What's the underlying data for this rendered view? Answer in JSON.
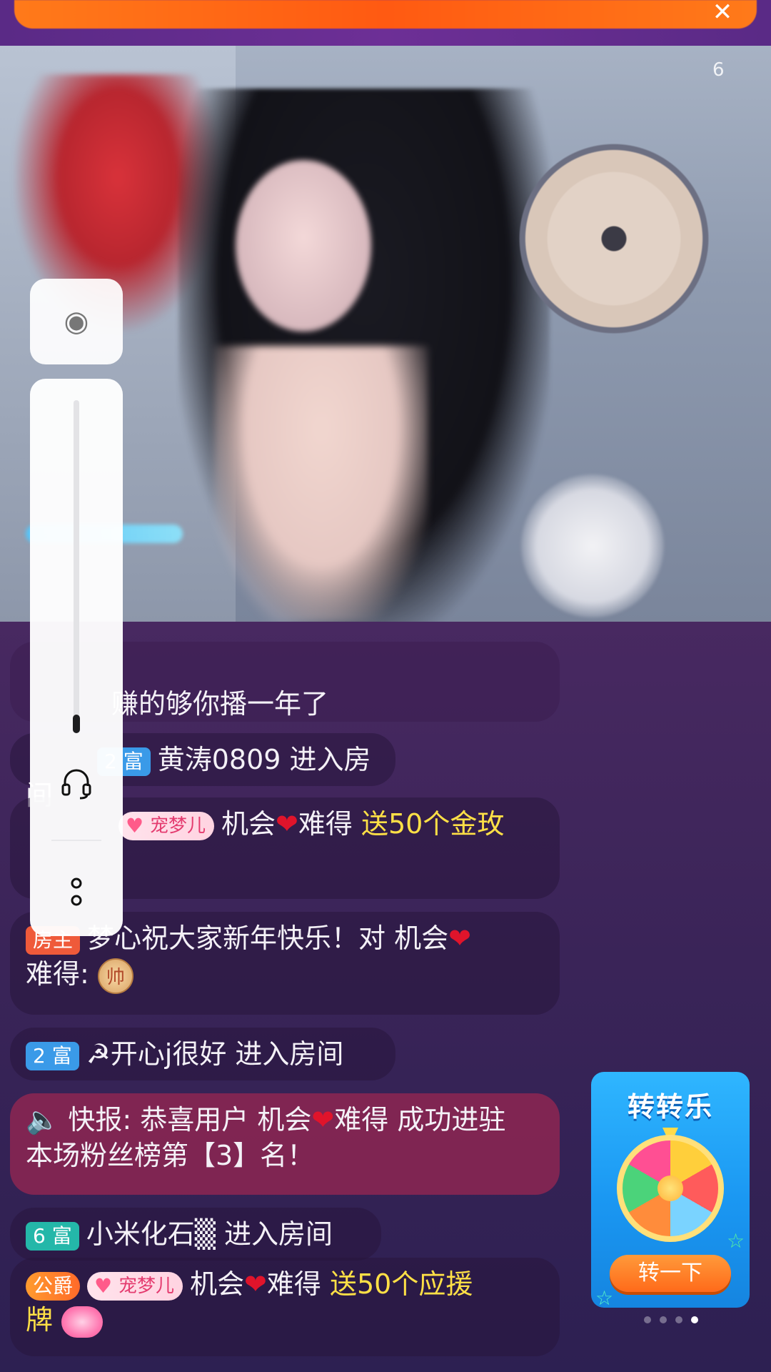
{
  "colors": {
    "accent_yellow": "#ffe046",
    "heart_red": "#e0142b",
    "badge_blue": "#3a9ae8",
    "badge_teal": "#24b7a9",
    "badge_red": "#ef5a3a",
    "game_blue": "#1a97f2",
    "spin_orange": "#ff6a1a"
  },
  "top_banner": {
    "close_icon": "close-icon"
  },
  "video": {
    "watermark_icon": "app-logo-icon"
  },
  "side_panel": {
    "top_icon": "toggle-icon",
    "headset_icon": "headset-icon",
    "more_icon": "more-vertical-icon"
  },
  "chat": [
    {
      "text_a": "赚的够你播一年了"
    },
    {
      "badge": "2 富",
      "text": "黄涛0809 进入房间"
    },
    {
      "pet": "宠梦儿",
      "user": "机会",
      "mid": "难得",
      "gift": "送50个金玫"
    },
    {
      "badge": "房主",
      "text": "梦心祝大家新年快乐！对 机会",
      "line2": "难得:",
      "coin": "帅"
    },
    {
      "badge": "2 富",
      "text": "☭开心j很好 进入房间"
    },
    {
      "icon": "speaker-icon",
      "line1": "快报: 恭喜用户 机会",
      "line1b": "难得 成功进驻",
      "line2": "本场粉丝榜第【3】名！"
    },
    {
      "badge": "6 富",
      "text": "小米化石▒ 进入房间"
    },
    {
      "badge": "公爵",
      "pet": "宠梦儿",
      "user": "机会",
      "mid": "难得",
      "gift": "送50个应援",
      "line2": "牌"
    }
  ],
  "game_widget": {
    "title": "转转乐",
    "button": "转一下",
    "page_count": 4,
    "active_page": 4
  }
}
